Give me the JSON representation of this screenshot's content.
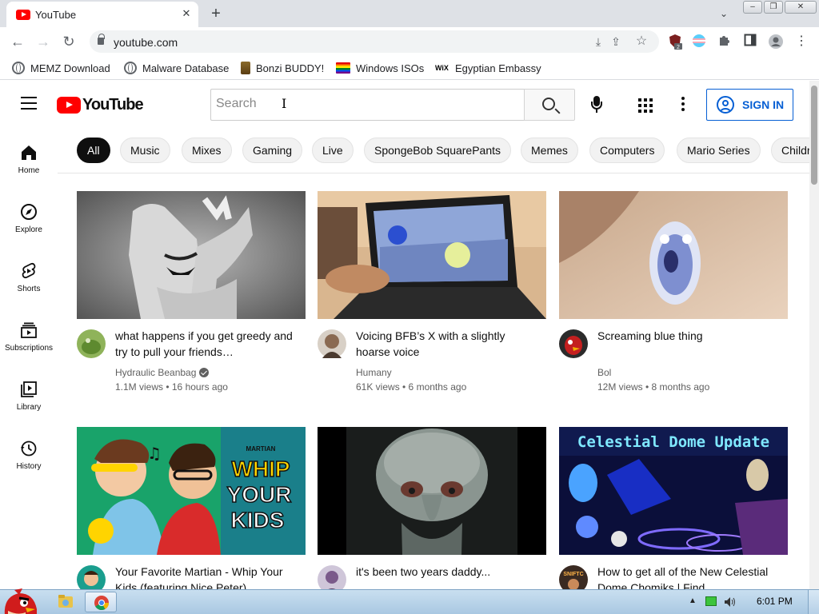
{
  "browser": {
    "tab_title": "YouTube",
    "url": "youtube.com",
    "extension_badge": "2"
  },
  "bookmarks": [
    {
      "label": "MEMZ Download",
      "icon": "globe-icon"
    },
    {
      "label": "Malware Database",
      "icon": "globe-icon"
    },
    {
      "label": "Bonzi BUDDY!",
      "icon": "bonzi-icon"
    },
    {
      "label": "Windows ISOs",
      "icon": "rainbow-flag-icon"
    },
    {
      "label": "Egyptian Embassy",
      "icon": "wix-icon",
      "icon_text": "WiX"
    }
  ],
  "youtube": {
    "logo_text": "YouTube",
    "search_placeholder": "Search",
    "signin_label": "SIGN IN",
    "chips": [
      "All",
      "Music",
      "Mixes",
      "Gaming",
      "Live",
      "SpongeBob SquarePants",
      "Memes",
      "Computers",
      "Mario Series",
      "Children's"
    ],
    "guide": [
      {
        "label": "Home",
        "icon": "home-icon"
      },
      {
        "label": "Explore",
        "icon": "compass-icon"
      },
      {
        "label": "Shorts",
        "icon": "shorts-icon"
      },
      {
        "label": "Subscriptions",
        "icon": "subscriptions-icon"
      },
      {
        "label": "Library",
        "icon": "library-icon"
      },
      {
        "label": "History",
        "icon": "history-icon"
      }
    ],
    "videos": [
      {
        "title": "what happens if you get greedy and try to pull your friends…",
        "channel": "Hydraulic Beanbag",
        "verified": true,
        "meta": "1.1M views • 16 hours ago"
      },
      {
        "title": "Voicing BFB’s X with a slightly hoarse voice",
        "channel": "Humany",
        "verified": false,
        "meta": "61K views • 6 months ago"
      },
      {
        "title": "Screaming blue thing",
        "channel": "Bol",
        "verified": false,
        "meta": "12M views • 8 months ago"
      },
      {
        "title": "Your Favorite Martian - Whip Your Kids (featuring Nice Peter)",
        "channel": "",
        "verified": false,
        "meta": ""
      },
      {
        "title": "it's been two years daddy...",
        "channel": "",
        "verified": false,
        "meta": ""
      },
      {
        "title": "How to get all of the New Celestial Dome Chomiks | Find…",
        "channel": "",
        "verified": false,
        "meta": ""
      }
    ],
    "thumb_text": {
      "martian_brand": "MARTIAN",
      "martian_line1": "WHIP",
      "martian_line2": "YOUR",
      "martian_line3": "KIDS",
      "celestial": "Celestial Dome Update",
      "avatar_text": "SNIFTC"
    }
  },
  "taskbar": {
    "clock": "6:01 PM"
  },
  "colors": {
    "yt_red": "#ff0000",
    "signin_blue": "#065fd4",
    "chip_active": "#0f0f0f"
  }
}
